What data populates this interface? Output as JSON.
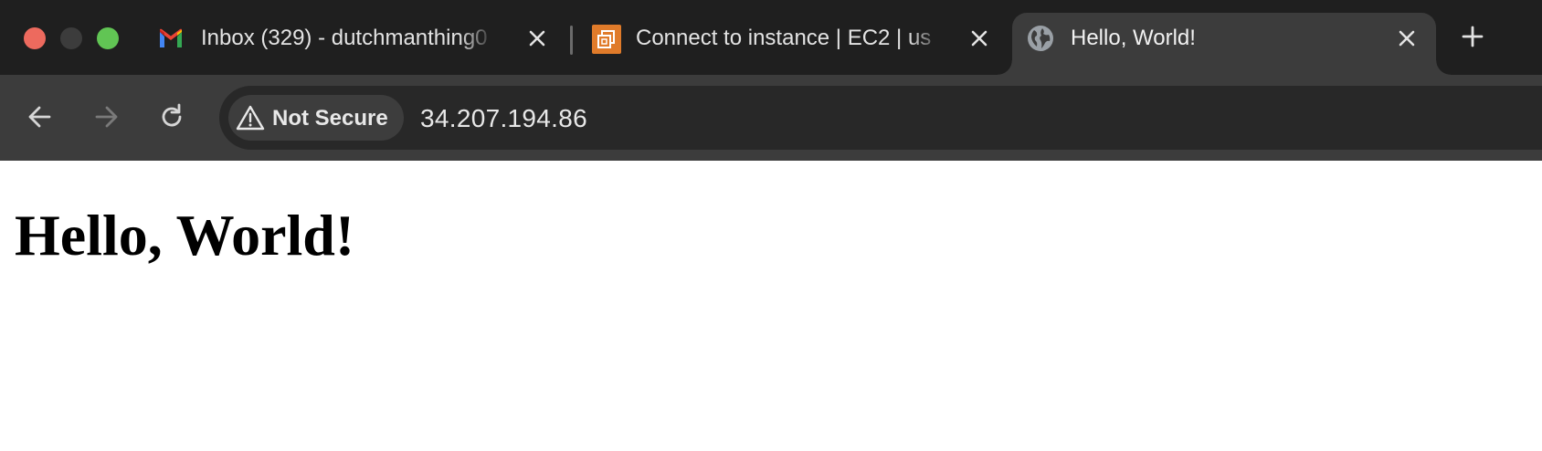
{
  "window": {
    "controls": [
      "close",
      "minimize",
      "maximize"
    ],
    "colors": {
      "close": "#ed6a5e",
      "minimize": "#3c3c3c",
      "maximize": "#61c554"
    }
  },
  "tabs": [
    {
      "title": "Inbox (329) - dutchmanthing0",
      "icon": "gmail-icon",
      "active": false
    },
    {
      "title": "Connect to instance | EC2 | us",
      "icon": "aws-ec2-icon",
      "active": false
    },
    {
      "title": "Hello, World!",
      "icon": "globe-icon",
      "active": true
    }
  ],
  "toolbar": {
    "security_chip": "Not Secure",
    "url": "34.207.194.86"
  },
  "page": {
    "heading": "Hello, World!"
  },
  "theme": {
    "tabstrip_bg": "#1f1f1f",
    "toolbar_bg": "#3c3c3c",
    "omnibox_bg": "#282828",
    "ec2_orange": "#e07b2a"
  }
}
